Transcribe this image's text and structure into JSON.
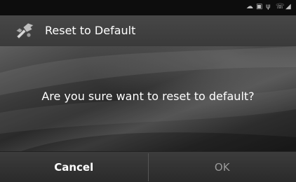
{
  "dialog": {
    "title": "Reset to Default",
    "message": "Are you sure want to reset to default?",
    "icon": "tools-icon"
  },
  "buttons": {
    "cancel_label": "Cancel",
    "ok_label": "OK"
  },
  "statusbar": {
    "icons": [
      "notification-icon",
      "sd-card-icon",
      "usb-icon",
      "phone-icon",
      "signal-icon"
    ]
  }
}
